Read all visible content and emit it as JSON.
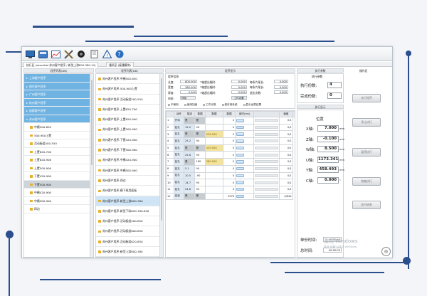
{
  "toolbar": {
    "icons": [
      "monitor-icon",
      "disk-icon",
      "chart-icon",
      "tools-icon",
      "record-icon",
      "document-icon",
      "warning-icon",
      "help-icon"
    ]
  },
  "tabs": [
    "执行区 (essential 苏州客户程序 / 新型上游800-380-14)",
    "通讯区 (接通模块)"
  ],
  "left_panel": {
    "header": "程序列表(DB)",
    "items": [
      {
        "label": "上海客户程序",
        "style": "hl"
      },
      {
        "label": "南京客户程序",
        "style": "hl"
      },
      {
        "label": "广州客户程序",
        "style": "hl"
      },
      {
        "label": "杭州客户程序",
        "style": "hl"
      },
      {
        "label": "成都客户程序",
        "style": "hl"
      },
      {
        "label": "苏州客户程序",
        "style": "hl",
        "expanded": true
      },
      {
        "label": "中横500-850",
        "style": ""
      },
      {
        "label": "500-900上置",
        "style": ""
      },
      {
        "label": "活动板组500-550",
        "style": ""
      },
      {
        "label": "上置620-700",
        "style": ""
      },
      {
        "label": "上置620-900",
        "style": ""
      },
      {
        "label": "上置500-900",
        "style": ""
      },
      {
        "label": "下置420-900",
        "style": ""
      },
      {
        "label": "下置500-900",
        "style": "grey"
      },
      {
        "label": "中横420-900",
        "style": ""
      },
      {
        "label": "中横500-900",
        "style": ""
      },
      {
        "label": "四边",
        "style": ""
      }
    ]
  },
  "mid_panel": {
    "header": "程序列表(DB)",
    "items": [
      {
        "label": "苏州客户程序-中横500-850",
        "style": ""
      },
      {
        "label": "苏州客户程序-500-900上置",
        "style": ""
      },
      {
        "label": "苏州客户程序-活动板组500-550",
        "style": ""
      },
      {
        "label": "苏州客户程序-上置620-700",
        "style": ""
      },
      {
        "label": "苏州客户程序-上置620-900",
        "style": ""
      },
      {
        "label": "苏州客户程序-上置500-900",
        "style": ""
      },
      {
        "label": "苏州客户程序-下置420-900",
        "style": ""
      },
      {
        "label": "苏州客户程序-下置500-900",
        "style": ""
      },
      {
        "label": "苏州客户程序-中横420-900",
        "style": ""
      },
      {
        "label": "苏州客户程序-中横500-900",
        "style": ""
      },
      {
        "label": "苏州客户程序-四边",
        "style": ""
      },
      {
        "label": "苏州客户程序-横下框用面板",
        "style": ""
      },
      {
        "label": "苏州客户程序-新型上游800-380",
        "style": "sel"
      },
      {
        "label": "苏州客户程序-新型下料850-780-850",
        "style": ""
      },
      {
        "label": "苏州客户程序-活动板组500-850",
        "style": ""
      },
      {
        "label": "苏州客户程序-活动板组600-850",
        "style": ""
      },
      {
        "label": "苏州客户程序-活动板组620-850",
        "style": ""
      },
      {
        "label": "苏州客户程序-新型上游800-380",
        "style": ""
      }
    ]
  },
  "program_info": {
    "header": "程序显示",
    "group_title": "程序信息",
    "fields": [
      {
        "label": "长度:",
        "value": "800.000",
        "label2": "T轴超出幅时:",
        "value2": "0.000",
        "label3": "每条片尾长:",
        "value3": "0.000"
      },
      {
        "label": "宽度:",
        "value": "380.000",
        "label2": "T轴超出幅时:",
        "value2": "0.000",
        "label3": "每条片尾长:",
        "value3": "0.000"
      },
      {
        "label": "厚度:",
        "value": "0.000",
        "label2": "T轴超出幅时:",
        "value2": "0.000",
        "label3": "退出次数:",
        "value3": "0.000"
      }
    ],
    "material_label": "材质:",
    "material_value": "铁板",
    "btn": "工件设置",
    "checks": [
      "不使用",
      "使用加速",
      "工件计数",
      "保存到系统",
      "显示运算结果"
    ]
  },
  "table": {
    "headers": [
      "动作",
      "描述",
      "数据",
      "数据",
      "数据",
      "用时(ms)",
      "",
      "速度",
      ""
    ],
    "rows": [
      {
        "n": "1",
        "name": "开料",
        "a": "是",
        "b": "是",
        "c": "",
        "ms": "0",
        "spd": "0/1"
      },
      {
        "n": "2",
        "name": "钻孔",
        "a": "12.0",
        "b": "90",
        "c": "",
        "ms": "0",
        "spd": "0/1"
      },
      {
        "n": "3",
        "name": "钻孔",
        "a": "是",
        "b": "是",
        "c": "235.000",
        "ms": "0",
        "spd": "0/1"
      },
      {
        "n": "4",
        "name": "钻孔",
        "a": "25.2",
        "b": "90",
        "c": "",
        "ms": "0",
        "spd": "0/1"
      },
      {
        "n": "5",
        "name": "钻孔",
        "a": "是",
        "b": "是",
        "c": "235.000",
        "ms": "0",
        "spd": "0/1"
      },
      {
        "n": "6",
        "name": "钻孔",
        "a": "25.6",
        "b": "90",
        "c": "",
        "ms": "0",
        "spd": "0/1"
      },
      {
        "n": "7",
        "name": "钻孔",
        "a": "是",
        "b": "180",
        "c": "280.000",
        "ms": "0",
        "spd": "0/1"
      },
      {
        "n": "8",
        "name": "钻孔",
        "a": "5.1",
        "b": "90",
        "c": "",
        "ms": "0",
        "spd": "0/1"
      },
      {
        "n": "9",
        "name": "钻孔",
        "a": "10.5",
        "b": "-90",
        "c": "",
        "ms": "0",
        "spd": "0/1"
      },
      {
        "n": "10",
        "name": "钻孔",
        "a": "14.7",
        "b": "90",
        "c": "",
        "ms": "0",
        "spd": "0/1"
      },
      {
        "n": "11",
        "name": "钻孔",
        "a": "24.8",
        "b": "90",
        "c": "",
        "ms": "0",
        "spd": "0/1"
      },
      {
        "n": "12",
        "name": "结束",
        "a": "是",
        "b": "是",
        "c": "",
        "ms": "2576",
        "spd": "0/644"
      }
    ]
  },
  "exec_params": {
    "header": "执行参数",
    "group": "执行参数",
    "count_label": "执行份数:",
    "count_value": "4",
    "done_label": "完成份数:",
    "done_value": "0"
  },
  "exec_display": {
    "header": "执行显示",
    "pos_title": "位置",
    "axes": [
      {
        "label": "X轴:",
        "value": "7.000",
        "unit": "mm"
      },
      {
        "label": "Z轴:",
        "value": "-0.100",
        "unit": "mm"
      },
      {
        "label": "W轴:",
        "value": "8.500",
        "unit": "mm"
      },
      {
        "label": "U轴:",
        "value": "1173.341",
        "unit": "mm"
      },
      {
        "label": "Y轴:",
        "value": "458.493",
        "unit": "mm"
      },
      {
        "label": "C轴:",
        "value": "0.000",
        "unit": "°"
      }
    ],
    "single_time_label": "单份时间:",
    "single_time_value": "00:00:00",
    "total_time_label": "总时间:",
    "total_time_value": "00:00:00"
  },
  "ops": {
    "header": "操作区",
    "buttons": [
      "执行程序",
      "停止执行",
      "暂停执行",
      "恢复执行",
      "执行结束"
    ]
  },
  "watermark": "激活 Windows",
  "watermark_sub": "转到\"设置\"以激活 Windows。"
}
